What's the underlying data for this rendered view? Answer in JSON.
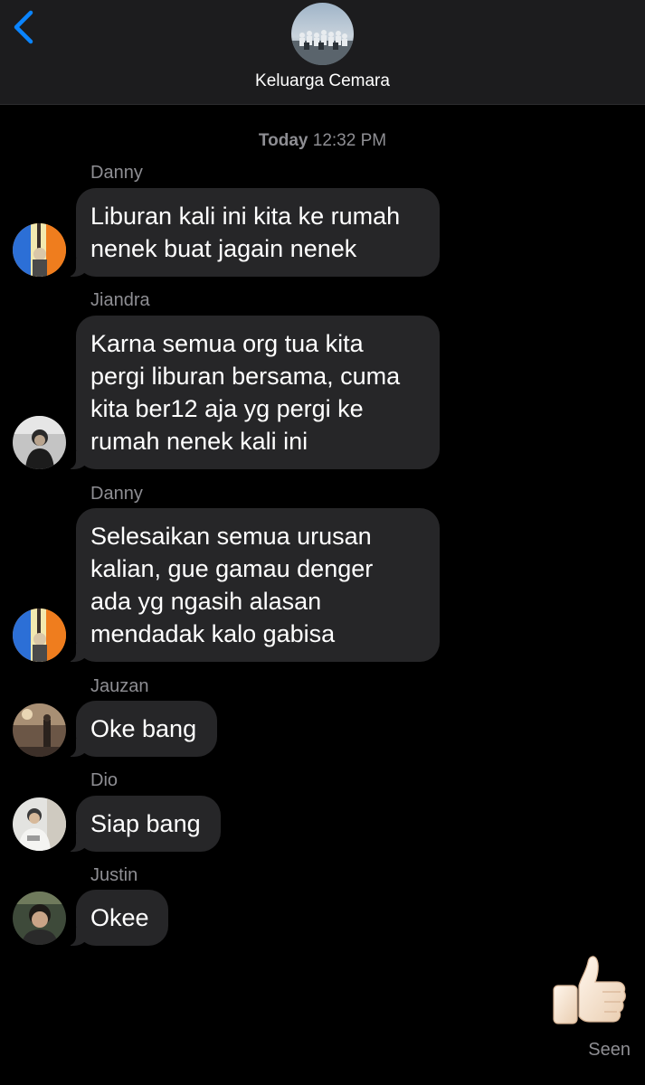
{
  "header": {
    "group_name": "Keluarga Cemara",
    "back_icon": "chevron-left-icon",
    "accent": "#0a84ff"
  },
  "timestamp": {
    "day": "Today",
    "time": "12:32 PM"
  },
  "messages": [
    {
      "sender": "Danny",
      "text": "Liburan kali ini kita ke rumah\nnenek buat jagain nenek"
    },
    {
      "sender": "Jiandra",
      "text": "Karna semua org tua kita\npergi liburan bersama, cuma\nkita ber12 aja yg pergi ke\nrumah nenek kali ini"
    },
    {
      "sender": "Danny",
      "text": "Selesaikan semua urusan\nkalian, gue gamau denger\nada yg ngasih alasan\nmendadak kalo gabisa"
    },
    {
      "sender": "Jauzan",
      "text": "Oke bang"
    },
    {
      "sender": "Dio",
      "text": "Siap bang"
    },
    {
      "sender": "Justin",
      "text": "Okee"
    }
  ],
  "reaction": {
    "icon": "thumbs-up-icon",
    "status": "Seen"
  },
  "colors": {
    "background": "#000000",
    "header_bg": "#1c1c1e",
    "bubble_bg": "#262628",
    "secondary_text": "#8e8e93"
  }
}
